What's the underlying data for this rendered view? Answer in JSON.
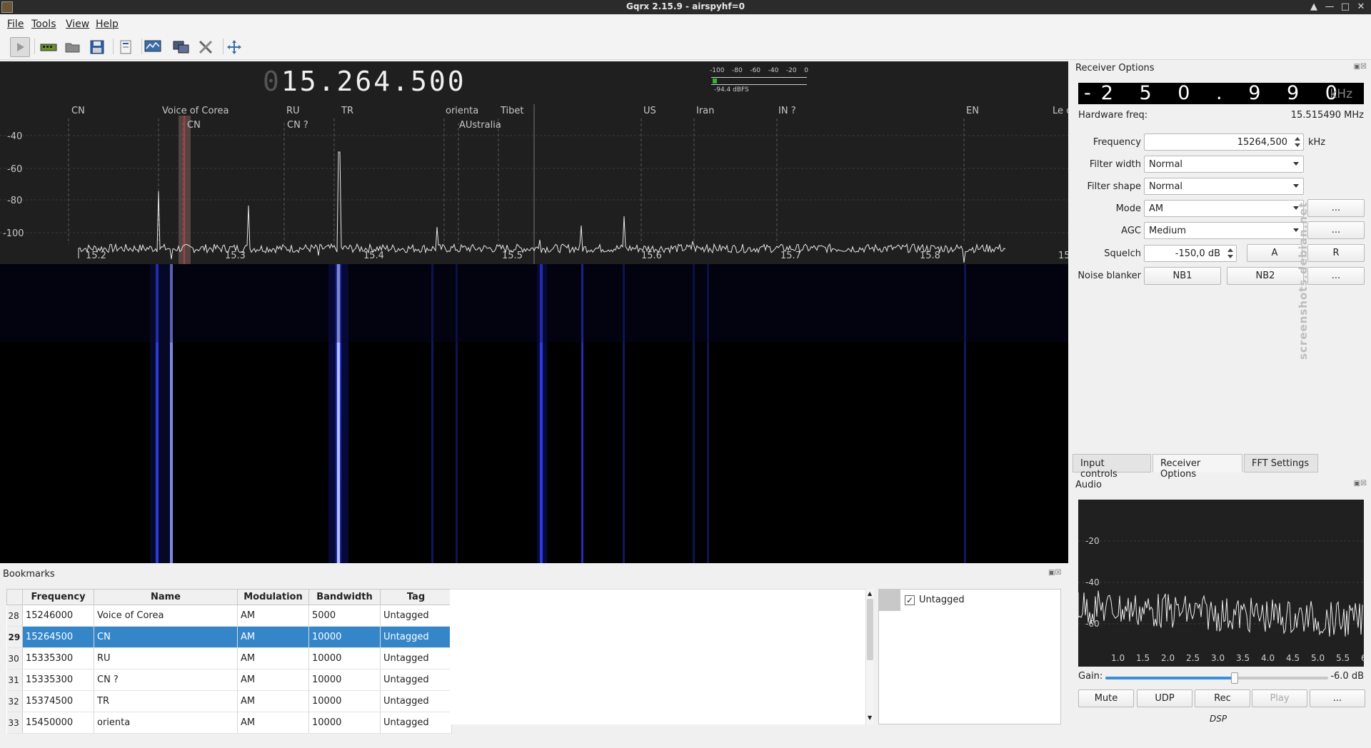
{
  "window": {
    "title": "Gqrx 2.15.9 - airspyhf=0",
    "buttons": [
      "▲",
      "—",
      "□",
      "✕"
    ]
  },
  "menu": [
    "File",
    "Tools",
    "View",
    "Help"
  ],
  "toolbar": [
    "play",
    "hardware",
    "open",
    "save",
    "bookmark",
    "display",
    "network",
    "tools",
    "fullscreen"
  ],
  "display": {
    "frequency_dim": "0",
    "frequency": "15.264.500",
    "meter_ticks": [
      "-100",
      "-80",
      "-60",
      "-40",
      "-20",
      "0"
    ],
    "meter_level": "-94.4 dBFS",
    "db_ticks": [
      "-40",
      "-60",
      "-80",
      "-100"
    ],
    "freq_ticks": [
      "15.2",
      "15.3",
      "15.4",
      "15.5",
      "15.6",
      "15.7",
      "15.8",
      "15"
    ],
    "bookmark_labels_top": [
      "CN",
      "Voice of Corea",
      "RU",
      "TR",
      "orienta",
      "Tibet",
      "US",
      "Iran",
      "IN ?",
      "EN",
      "Le c"
    ],
    "bookmark_labels_bottom": [
      "CN",
      "CN ?",
      "AUstralia"
    ]
  },
  "receiver": {
    "panel_title": "Receiver Options",
    "lcd_digits": "-2 5 0 . 9 9 0",
    "lcd_unit": "kHz",
    "hardware_freq_label": "Hardware freq:",
    "hardware_freq": "15.515490 MHz",
    "frequency_label": "Frequency",
    "frequency_value": "15264,500",
    "frequency_unit": "kHz",
    "filter_width_label": "Filter width",
    "filter_width": "Normal",
    "filter_shape_label": "Filter shape",
    "filter_shape": "Normal",
    "mode_label": "Mode",
    "mode": "AM",
    "agc_label": "AGC",
    "agc": "Medium",
    "squelch_label": "Squelch",
    "squelch": "-150,0 dB",
    "squelch_a": "A",
    "squelch_r": "R",
    "noise_label": "Noise blanker",
    "nb1": "NB1",
    "nb2": "NB2",
    "more": "..."
  },
  "watermark": "screenshots.debian.net",
  "tabs": [
    "Input controls",
    "Receiver Options",
    "FFT Settings"
  ],
  "audio": {
    "title": "Audio",
    "y_ticks": [
      "-20",
      "-40",
      "-60"
    ],
    "x_ticks": [
      "1.0",
      "1.5",
      "2.0",
      "2.5",
      "3.0",
      "3.5",
      "4.0",
      "4.5",
      "5.0",
      "5.5",
      "6"
    ],
    "gain_label": "Gain:",
    "gain_value": "-6.0 dB",
    "gain_level": 0.58,
    "buttons": [
      "Mute",
      "UDP",
      "Rec",
      "Play",
      "..."
    ],
    "dsp_label": "DSP"
  },
  "bookmarks": {
    "title": "Bookmarks",
    "columns": [
      "Frequency",
      "Name",
      "Modulation",
      "Bandwidth",
      "Tag"
    ],
    "rows": [
      {
        "n": "28",
        "freq": "15246000",
        "name": "Voice of Corea",
        "mod": "AM",
        "bw": "5000",
        "tag": "Untagged"
      },
      {
        "n": "29",
        "freq": "15264500",
        "name": "CN",
        "mod": "AM",
        "bw": "10000",
        "tag": "Untagged"
      },
      {
        "n": "30",
        "freq": "15335300",
        "name": "RU",
        "mod": "AM",
        "bw": "10000",
        "tag": "Untagged"
      },
      {
        "n": "31",
        "freq": "15335300",
        "name": "CN ?",
        "mod": "AM",
        "bw": "10000",
        "tag": "Untagged"
      },
      {
        "n": "32",
        "freq": "15374500",
        "name": "TR",
        "mod": "AM",
        "bw": "10000",
        "tag": "Untagged"
      },
      {
        "n": "33",
        "freq": "15450000",
        "name": "orienta",
        "mod": "AM",
        "bw": "10000",
        "tag": "Untagged"
      }
    ],
    "tag_label": "Untagged"
  }
}
